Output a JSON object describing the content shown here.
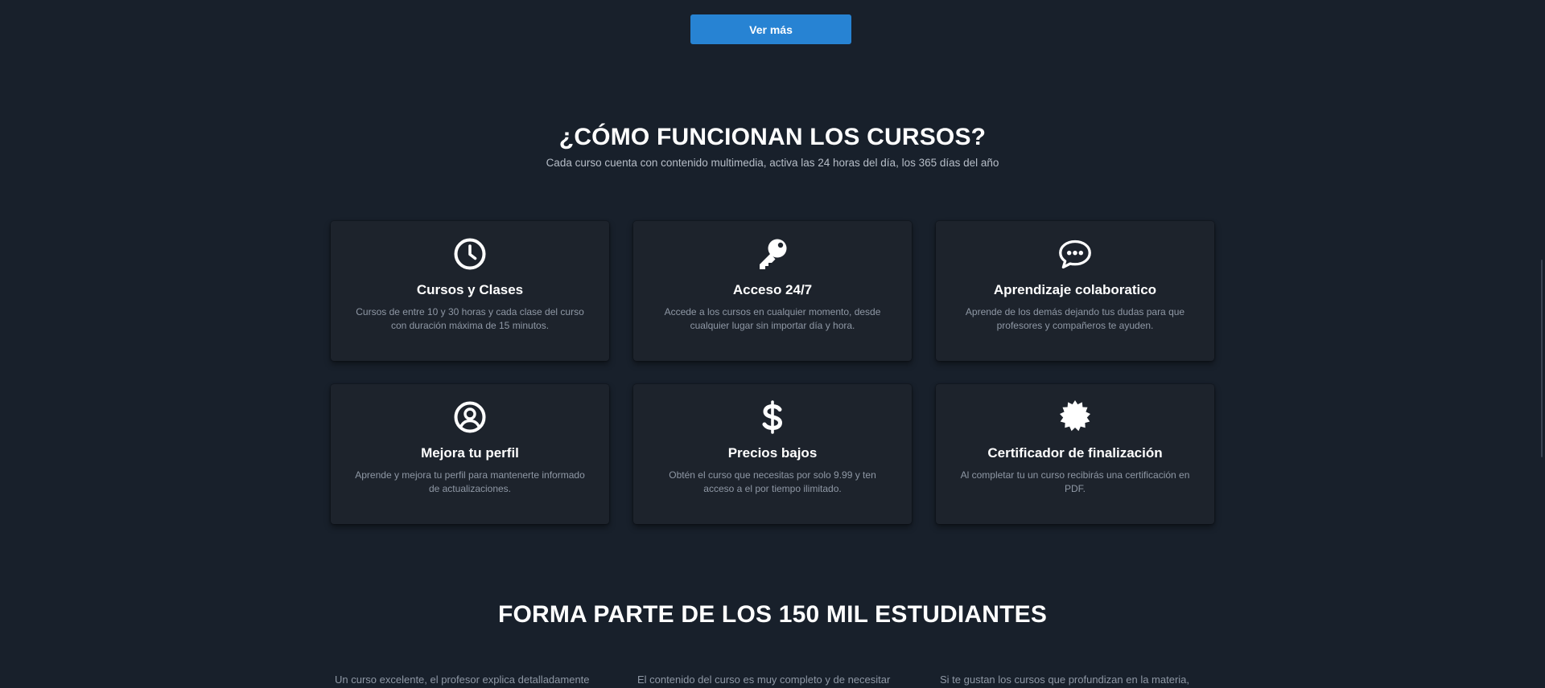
{
  "top": {
    "ver_mas_label": "Ver más"
  },
  "how": {
    "title": "¿CÓMO FUNCIONAN LOS CURSOS?",
    "subtitle": "Cada curso cuenta con contenido multimedia, activa las 24 horas del día, los 365 días del año"
  },
  "features": [
    {
      "icon": "clock-icon",
      "title": "Cursos y Clases",
      "text": "Cursos de entre 10 y 30 horas y cada clase del curso con duración máxima de 15 minutos."
    },
    {
      "icon": "key-icon",
      "title": "Acceso 24/7",
      "text": "Accede a los cursos en cualquier momento, desde cualquier lugar sin importar día y hora."
    },
    {
      "icon": "chat-bubble-icon",
      "title": "Aprendizaje colaboratico",
      "text": "Aprende de los demás dejando tus dudas para que profesores y compañeros te ayuden."
    },
    {
      "icon": "user-circle-icon",
      "title": "Mejora tu perfil",
      "text": "Aprende y mejora tu perfil para mantenerte informado de actualizaciones."
    },
    {
      "icon": "dollar-icon",
      "title": "Precios bajos",
      "text": "Obtén el curso que necesitas por solo 9.99 y ten acceso a el por tiempo ilimitado."
    },
    {
      "icon": "certificate-badge-icon",
      "title": "Certificador de finalización",
      "text": "Al completar tu un curso recibirás una certificación en PDF."
    }
  ],
  "students": {
    "title": "FORMA PARTE DE LOS 150 MIL ESTUDIANTES"
  },
  "testimonials": [
    {
      "text": "Un curso excelente, el profesor explica detalladamente"
    },
    {
      "text": "El contenido del curso es muy completo y de necesitar"
    },
    {
      "text": "Si te gustan los cursos que profundizan en la materia,"
    }
  ],
  "colors": {
    "background": "#18202b",
    "card_background": "#1d232c",
    "accent_button": "#2783d3",
    "muted_text": "#8f98a5"
  }
}
